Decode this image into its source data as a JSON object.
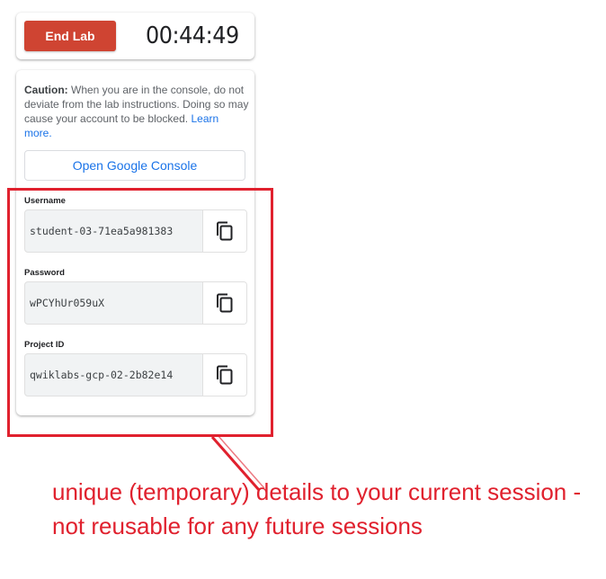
{
  "timer_card": {
    "end_lab_label": "End Lab",
    "timer": "00:44:49"
  },
  "details_card": {
    "caution_label": "Caution:",
    "caution_text": " When you are in the console, do not deviate from the lab instructions. Doing so may cause your account to be blocked.",
    "learn_more": "Learn more.",
    "console_button": "Open Google Console",
    "fields": [
      {
        "label": "Username",
        "value": "student-03-71ea5a981383"
      },
      {
        "label": "Password",
        "value": "wPCYhUr059uX"
      },
      {
        "label": "Project ID",
        "value": "qwiklabs-gcp-02-2b82e14"
      }
    ],
    "copy_icon": "copy-icon"
  },
  "annotation": {
    "text": "unique (temporary) details to your current session - not reusable for any future sessions",
    "color": "#e0212e"
  },
  "colors": {
    "end_lab": "#cf4432",
    "link": "#1a73e8",
    "annotation": "#e0212e"
  }
}
